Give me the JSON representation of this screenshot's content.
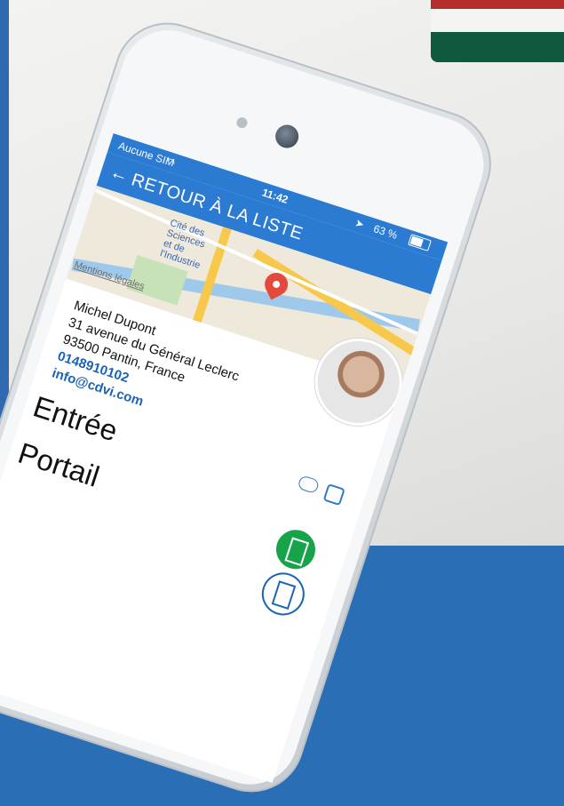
{
  "statusbar": {
    "carrier": "Aucune SIM",
    "time": "11:42",
    "battery": "63 %"
  },
  "appbar": {
    "back_label": "RETOUR À LA LISTE"
  },
  "map": {
    "poi_lines": [
      "Cité des",
      "Sciences",
      "et de",
      "l'Industrie"
    ],
    "legal": "Mentions légales"
  },
  "contact": {
    "name": "Michel Dupont",
    "address_line1": "31 avenue du Général Leclerc",
    "address_line2": "93500 Pantin, France",
    "phone": "0148910102",
    "email": "info@cdvi.com"
  },
  "doors": [
    "Entrée",
    "Portail"
  ],
  "colors": {
    "primary": "#2c7bd2",
    "open_door": "#16a34a",
    "map_pin": "#e34a3c",
    "link": "#1b63b6"
  },
  "icons": [
    "back-arrow-icon",
    "wifi-icon",
    "location-arrow-icon",
    "battery-icon",
    "chat-icon",
    "call-icon",
    "door-open-icon",
    "door-closed-icon",
    "map-pin-icon"
  ]
}
